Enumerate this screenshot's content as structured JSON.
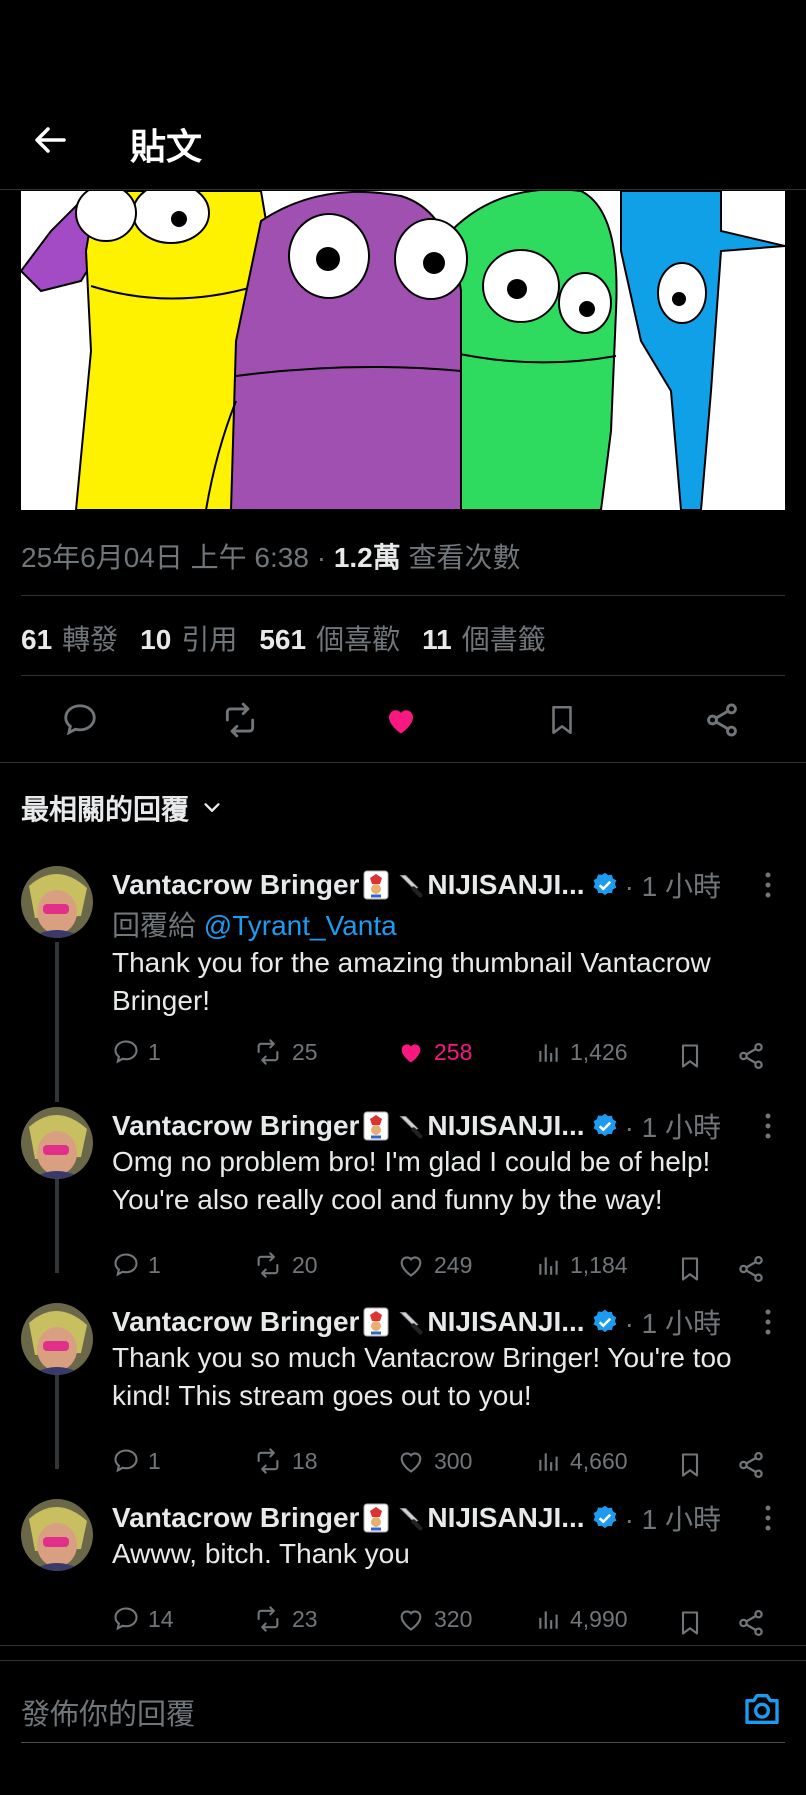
{
  "header": {
    "title": "貼文"
  },
  "post": {
    "timestamp": "25年6月04日 上午 6:38 · ",
    "views_count": "1.2萬",
    "views_label": " 查看次數",
    "stats": [
      {
        "count": "61",
        "label": "轉發"
      },
      {
        "count": "10",
        "label": "引用"
      },
      {
        "count": "561",
        "label": "個喜歡"
      },
      {
        "count": "11",
        "label": "個書籤"
      }
    ],
    "icons": [
      "reply-icon",
      "retweet-icon",
      "like-icon",
      "bookmark-icon",
      "share-icon"
    ],
    "liked": true
  },
  "sort": {
    "label": "最相關的回覆"
  },
  "replies": [
    {
      "name": "Vantacrow Bringer",
      "name_suffix": "NIJISANJI...",
      "time": "· 1 小時",
      "reply_to_label": "回覆給 ",
      "reply_to_handle": "@Tyrant_Vanta",
      "text": "Thank you for the amazing thumbnail Vantacrow Bringer!",
      "replies": "1",
      "retweets": "25",
      "likes": "258",
      "views": "1,426",
      "liked": true
    },
    {
      "name": "Vantacrow Bringer",
      "name_suffix": "NIJISANJI...",
      "time": "· 1 小時",
      "text": "Omg no problem bro! I'm glad I could be of help! You're also really cool and funny by the way!",
      "replies": "1",
      "retweets": "20",
      "likes": "249",
      "views": "1,184",
      "liked": false
    },
    {
      "name": "Vantacrow Bringer",
      "name_suffix": "NIJISANJI...",
      "time": "· 1 小時",
      "text": "Thank you so much Vantacrow Bringer! You're too kind! This stream goes out to you!",
      "replies": "1",
      "retweets": "18",
      "likes": "300",
      "views": "4,660",
      "liked": false
    },
    {
      "name": "Vantacrow Bringer",
      "name_suffix": "NIJISANJI...",
      "time": "· 1 小時",
      "text": "Awww, bitch. Thank you",
      "replies": "14",
      "retweets": "23",
      "likes": "320",
      "views": "4,990",
      "liked": false
    }
  ],
  "compose": {
    "placeholder": "發佈你的回覆"
  },
  "colors": {
    "accent": "#1d9bf0",
    "like": "#f91880",
    "muted": "#71767b"
  }
}
